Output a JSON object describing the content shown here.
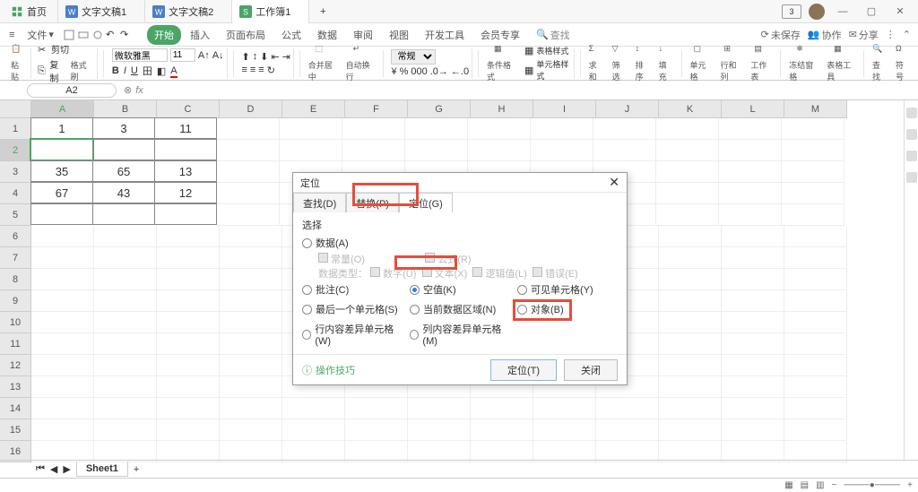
{
  "titlebar": {
    "home": "首页",
    "tabs": [
      {
        "label": "文字文稿1",
        "type": "doc"
      },
      {
        "label": "文字文稿2",
        "type": "doc"
      },
      {
        "label": "工作簿1",
        "type": "sheet",
        "active": true
      }
    ],
    "badge": "3"
  },
  "menubar": {
    "file_menu": "文件",
    "ribbon_tabs": [
      "开始",
      "插入",
      "页面布局",
      "公式",
      "数据",
      "审阅",
      "视图",
      "开发工具",
      "会员专享"
    ],
    "active_tab": 0,
    "search_placeholder": "查找",
    "right": {
      "unsaved": "未保存",
      "coop": "协作",
      "share": "分享"
    }
  },
  "ribbon": {
    "clipboard": {
      "cut": "剪切",
      "copy": "复制",
      "paste": "粘贴",
      "brush": "格式刷"
    },
    "font": {
      "name": "微软雅黑",
      "size": "11"
    },
    "merge": "合并居中",
    "wrap": "自动换行",
    "fmt_general": "常规",
    "cond_fmt": "条件格式",
    "cell_style": "单元格样式",
    "table_style": "表格样式",
    "sum": "求和",
    "filter": "筛选",
    "sort": "排序",
    "fill": "填充",
    "cell": "单元格",
    "rowcol": "行和列",
    "sheet": "工作表",
    "freeze": "冻结窗格",
    "tools": "表格工具",
    "find": "查找",
    "symbol": "符号"
  },
  "formula": {
    "namebox": "A2",
    "fx": "fx"
  },
  "sheet": {
    "cols": [
      "A",
      "B",
      "C",
      "D",
      "E",
      "F",
      "G",
      "H",
      "I",
      "J",
      "K",
      "L",
      "M"
    ],
    "rows": 16,
    "active_cell": {
      "r": 1,
      "c": 0
    },
    "data": [
      [
        "1",
        "3",
        "11"
      ],
      [
        "",
        "",
        ""
      ],
      [
        "35",
        "65",
        "13"
      ],
      [
        "67",
        "43",
        "12"
      ],
      [
        "",
        "",
        ""
      ]
    ]
  },
  "dialog": {
    "title": "定位",
    "tabs": [
      "查找(D)",
      "替换(P)",
      "定位(G)"
    ],
    "active_tab": 2,
    "section_choose": "选择",
    "options": {
      "data": "数据(A)",
      "const": "常量(O)",
      "formula": "公式(R)",
      "type_label": "数据类型：",
      "type_num": "数字(U)",
      "type_text": "文本(X)",
      "type_bool": "逻辑值(L)",
      "type_err": "错误(E)",
      "comment": "批注(C)",
      "blank": "空值(K)",
      "visible": "可见单元格(Y)",
      "last": "最后一个单元格(S)",
      "cur_region": "当前数据区域(N)",
      "object": "对象(B)",
      "row_diff": "行内容差异单元格(W)",
      "col_diff": "列内容差异单元格(M)"
    },
    "selected": "blank",
    "tip": "操作技巧",
    "btn_locate": "定位(T)",
    "btn_close": "关闭"
  },
  "bottom": {
    "sheet_tab": "Sheet1",
    "add": "+"
  }
}
